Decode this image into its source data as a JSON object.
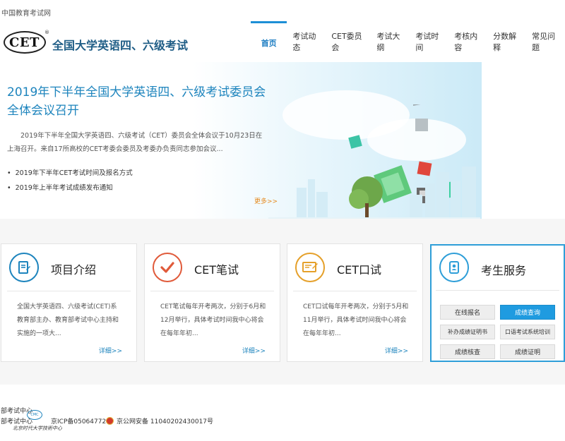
{
  "topbar": {
    "site_name": "中国教育考试网"
  },
  "header": {
    "logo_text": "CET",
    "logo_reg": "®",
    "brand_title": "全国大学英语四、六级考试"
  },
  "nav": {
    "items": [
      {
        "label": "首页"
      },
      {
        "label": "考试动态"
      },
      {
        "label": "CET委员会"
      },
      {
        "label": "考试大纲"
      },
      {
        "label": "考试时间"
      },
      {
        "label": "考核内容"
      },
      {
        "label": "分数解释"
      },
      {
        "label": "常见问题"
      }
    ]
  },
  "hero": {
    "title_line1": "2019年下半年全国大学英语四、六级考试委员会",
    "title_line2": "全体会议召开",
    "desc": "2019年下半年全国大学英语四、六级考试（CET）委员会全体会议于10月23日在上海召开。来自17所高校的CET考委会委员及考委办负责同志参加会议...",
    "links": [
      {
        "label": "2019年下半年CET考试时间及报名方式"
      },
      {
        "label": "2019年上半年考试成绩发布通知"
      }
    ],
    "more": "更多>>"
  },
  "cards": [
    {
      "title": "项目介绍",
      "desc": "全国大学英语四、六级考试(CET)系教育部主办、教育部考试中心主持和实施的一项大...",
      "detail": "详细>>",
      "icon": "document-icon",
      "color": "#1d84bd"
    },
    {
      "title": "CET笔试",
      "desc": "CET笔试每年开考两次，分别于6月和12月举行，具体考试时间我中心将会在每年年初...",
      "detail": "详细>>",
      "icon": "checkmark-icon",
      "color": "#e05a3a"
    },
    {
      "title": "CET口试",
      "desc": "CET口试每年开考两次，分别于5月和11月举行，具体考试时间我中心将会在每年年初...",
      "detail": "详细>>",
      "icon": "certificate-icon",
      "color": "#e5a02a"
    }
  ],
  "service": {
    "title": "考生服务",
    "icon": "contacts-icon",
    "buttons": [
      {
        "label": "在线报名"
      },
      {
        "label": "成绩查询"
      },
      {
        "label": "补办成绩证明书"
      },
      {
        "label": "口语考试系统培训"
      },
      {
        "label": "成绩核查"
      },
      {
        "label": "成绩证明"
      }
    ]
  },
  "footer": {
    "line1": "部考试中心",
    "line2": "部考试中心",
    "cmc": "CMC",
    "icp": "京ICP备05064772号",
    "police": "京公网安备 11040202430017号",
    "sig": "北京时代大学技術中心"
  },
  "colors": {
    "accent": "#1d84bd",
    "nav_active": "#1d8fd6",
    "service_border": "#2e9ed8",
    "primary_button": "#1f9be0",
    "more_link": "#e58a1f"
  }
}
